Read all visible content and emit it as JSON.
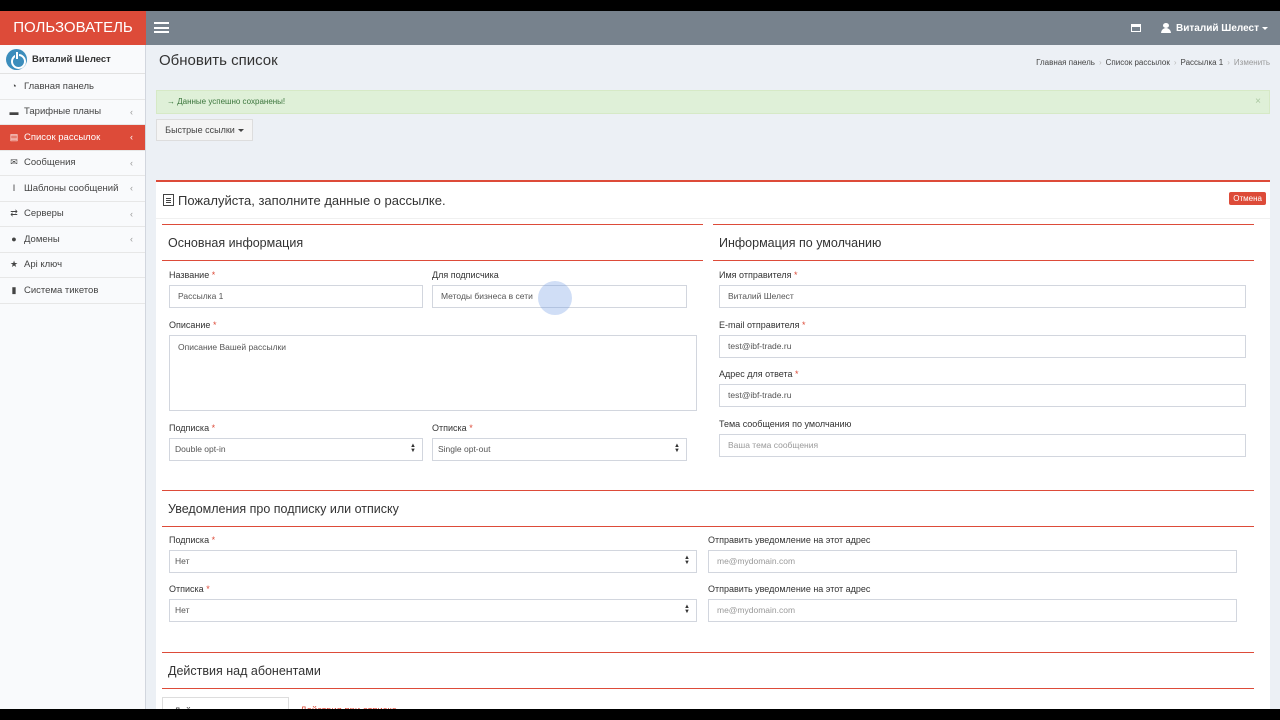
{
  "app": {
    "logo": "ПОЛЬЗОВАТЕЛЬ",
    "user_name": "Виталий Шелест"
  },
  "sidebar": {
    "user": "Виталий Шелест",
    "items": [
      {
        "label": "Главная панель",
        "icon": "clock-icon"
      },
      {
        "label": "Тарифные планы",
        "icon": "card-icon",
        "chevron": "‹"
      },
      {
        "label": "Список рассылок",
        "icon": "list-icon",
        "chevron": "‹",
        "active": true
      },
      {
        "label": "Сообщения",
        "icon": "envelope-icon",
        "chevron": "‹"
      },
      {
        "label": "Шаблоны сообщений",
        "icon": "text-cursor-icon",
        "chevron": "‹"
      },
      {
        "label": "Серверы",
        "icon": "exchange-icon",
        "chevron": "‹"
      },
      {
        "label": "Домены",
        "icon": "globe-icon",
        "chevron": "‹"
      },
      {
        "label": "Api ключ",
        "icon": "star-icon"
      },
      {
        "label": "Система тикетов",
        "icon": "ticket-icon"
      }
    ]
  },
  "header": {
    "title": "Обновить список",
    "breadcrumb": [
      "Главная панель",
      "Список рассылок",
      "Рассылка 1",
      "Изменить"
    ]
  },
  "alert": {
    "text": "→ Данные успешно сохранены!",
    "close": "×"
  },
  "quick_links": "Быстрые ссылки",
  "form": {
    "title": "Пожалуйста, заполните данные о рассылке.",
    "cancel": "Отмена",
    "basic": {
      "title": "Основная информация",
      "name_label": "Название",
      "name_value": "Рассылка 1",
      "for_sub_label": "Для подписчика",
      "for_sub_value": "Методы бизнеса в сети",
      "desc_label": "Описание",
      "desc_value": "Описание Вашей рассылки",
      "subscribe_label": "Подписка",
      "subscribe_value": "Double opt-in",
      "unsubscribe_label": "Отписка",
      "unsubscribe_value": "Single opt-out"
    },
    "defaults": {
      "title": "Информация по умолчанию",
      "sender_name_label": "Имя отправителя",
      "sender_name_value": "Виталий Шелест",
      "sender_email_label": "E-mail отправителя",
      "sender_email_value": "test@ibf-trade.ru",
      "reply_label": "Адрес для ответа",
      "reply_value": "test@ibf-trade.ru",
      "subject_label": "Тема сообщения по умолчанию",
      "subject_placeholder": "Ваша тема сообщения"
    },
    "notify": {
      "title": "Уведомления про подписку или отписку",
      "sub_label": "Подписка",
      "sub_value": "Нет",
      "sub_addr_label": "Отправить уведомление на этот адрес",
      "sub_addr_placeholder": "me@mydomain.com",
      "unsub_label": "Отписка",
      "unsub_value": "Нет",
      "unsub_addr_label": "Отправить уведомление на этот адрес",
      "unsub_addr_placeholder": "me@mydomain.com"
    },
    "actions": {
      "title": "Действия над абонентами",
      "tab_subscribe": "Действия при подписке",
      "tab_unsubscribe": "Действия при отписке"
    }
  },
  "required_mark": "*",
  "colors": {
    "accent": "#dd4b39",
    "navbar": "#77828d",
    "success_bg": "#dff0d8"
  }
}
